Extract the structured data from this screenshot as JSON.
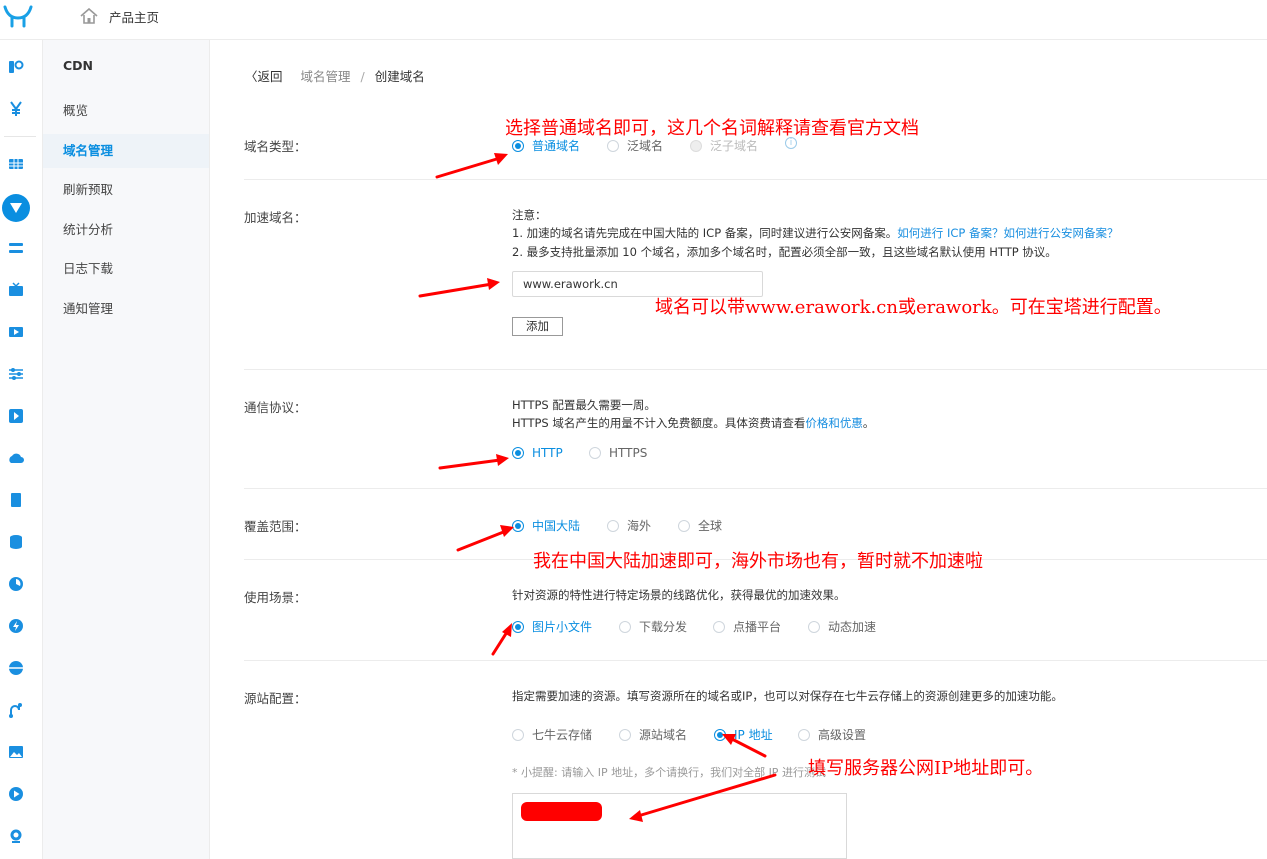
{
  "header": {
    "home_label": "产品主页"
  },
  "sidebar": {
    "title": "CDN",
    "items": [
      {
        "label": "概览"
      },
      {
        "label": "域名管理"
      },
      {
        "label": "刷新预取"
      },
      {
        "label": "统计分析"
      },
      {
        "label": "日志下载"
      },
      {
        "label": "通知管理"
      }
    ]
  },
  "breadcrumb": {
    "back": "〈返回",
    "parent": "域名管理",
    "separator": "/",
    "current": "创建域名"
  },
  "form": {
    "domain_type": {
      "label": "域名类型：",
      "options": [
        "普通域名",
        "泛域名",
        "泛子域名"
      ],
      "selected": "普通域名"
    },
    "accel_domain": {
      "label": "加速域名：",
      "note_title": "注意：",
      "note1": "1. 加速的域名请先完成在中国大陆的 ICP 备案，同时建议进行公安网备案。",
      "note1_link1": "如何进行 ICP 备案？",
      "note1_link2": "如何进行公安网备案？",
      "note2": "2. 最多支持批量添加 10 个域名，添加多个域名时，配置必须全部一致，且这些域名默认使用 HTTP 协议。",
      "input_value": "www.erawork.cn",
      "add_button": "添加"
    },
    "protocol": {
      "label": "通信协议：",
      "line1": "HTTPS 配置最久需要一周。",
      "line2": "HTTPS 域名产生的用量不计入免费额度。具体资费请查看",
      "line2_link": "价格和优惠",
      "line2_end": "。",
      "options": [
        "HTTP",
        "HTTPS"
      ],
      "selected": "HTTP"
    },
    "coverage": {
      "label": "覆盖范围：",
      "options": [
        "中国大陆",
        "海外",
        "全球"
      ],
      "selected": "中国大陆"
    },
    "scenario": {
      "label": "使用场景：",
      "desc": "针对资源的特性进行特定场景的线路优化，获得最优的加速效果。",
      "options": [
        "图片小文件",
        "下载分发",
        "点播平台",
        "动态加速"
      ],
      "selected": "图片小文件"
    },
    "origin": {
      "label": "源站配置：",
      "desc": "指定需要加速的资源。填写资源所在的域名或IP，也可以对保存在七牛云存储上的资源创建更多的加速功能。",
      "options": [
        "七牛云存储",
        "源站域名",
        "IP 地址",
        "高级设置"
      ],
      "selected": "IP 地址",
      "hint": "* 小提醒: 请输入 IP 地址，多个请换行，我们对全部 IP 进行测试"
    }
  },
  "annotations": {
    "a1": "选择普通域名即可，这几个名词解释请查看官方文档",
    "a2": "域名可以带www.erawork.cn或erawork。可在宝塔进行配置。",
    "a3": "我在中国大陆加速即可，海外市场也有，暂时就不加速啦",
    "a4": "填写服务器公网IP地址即可。"
  },
  "colors": {
    "accent": "#0a8ee0",
    "annotation": "#ff0000"
  }
}
